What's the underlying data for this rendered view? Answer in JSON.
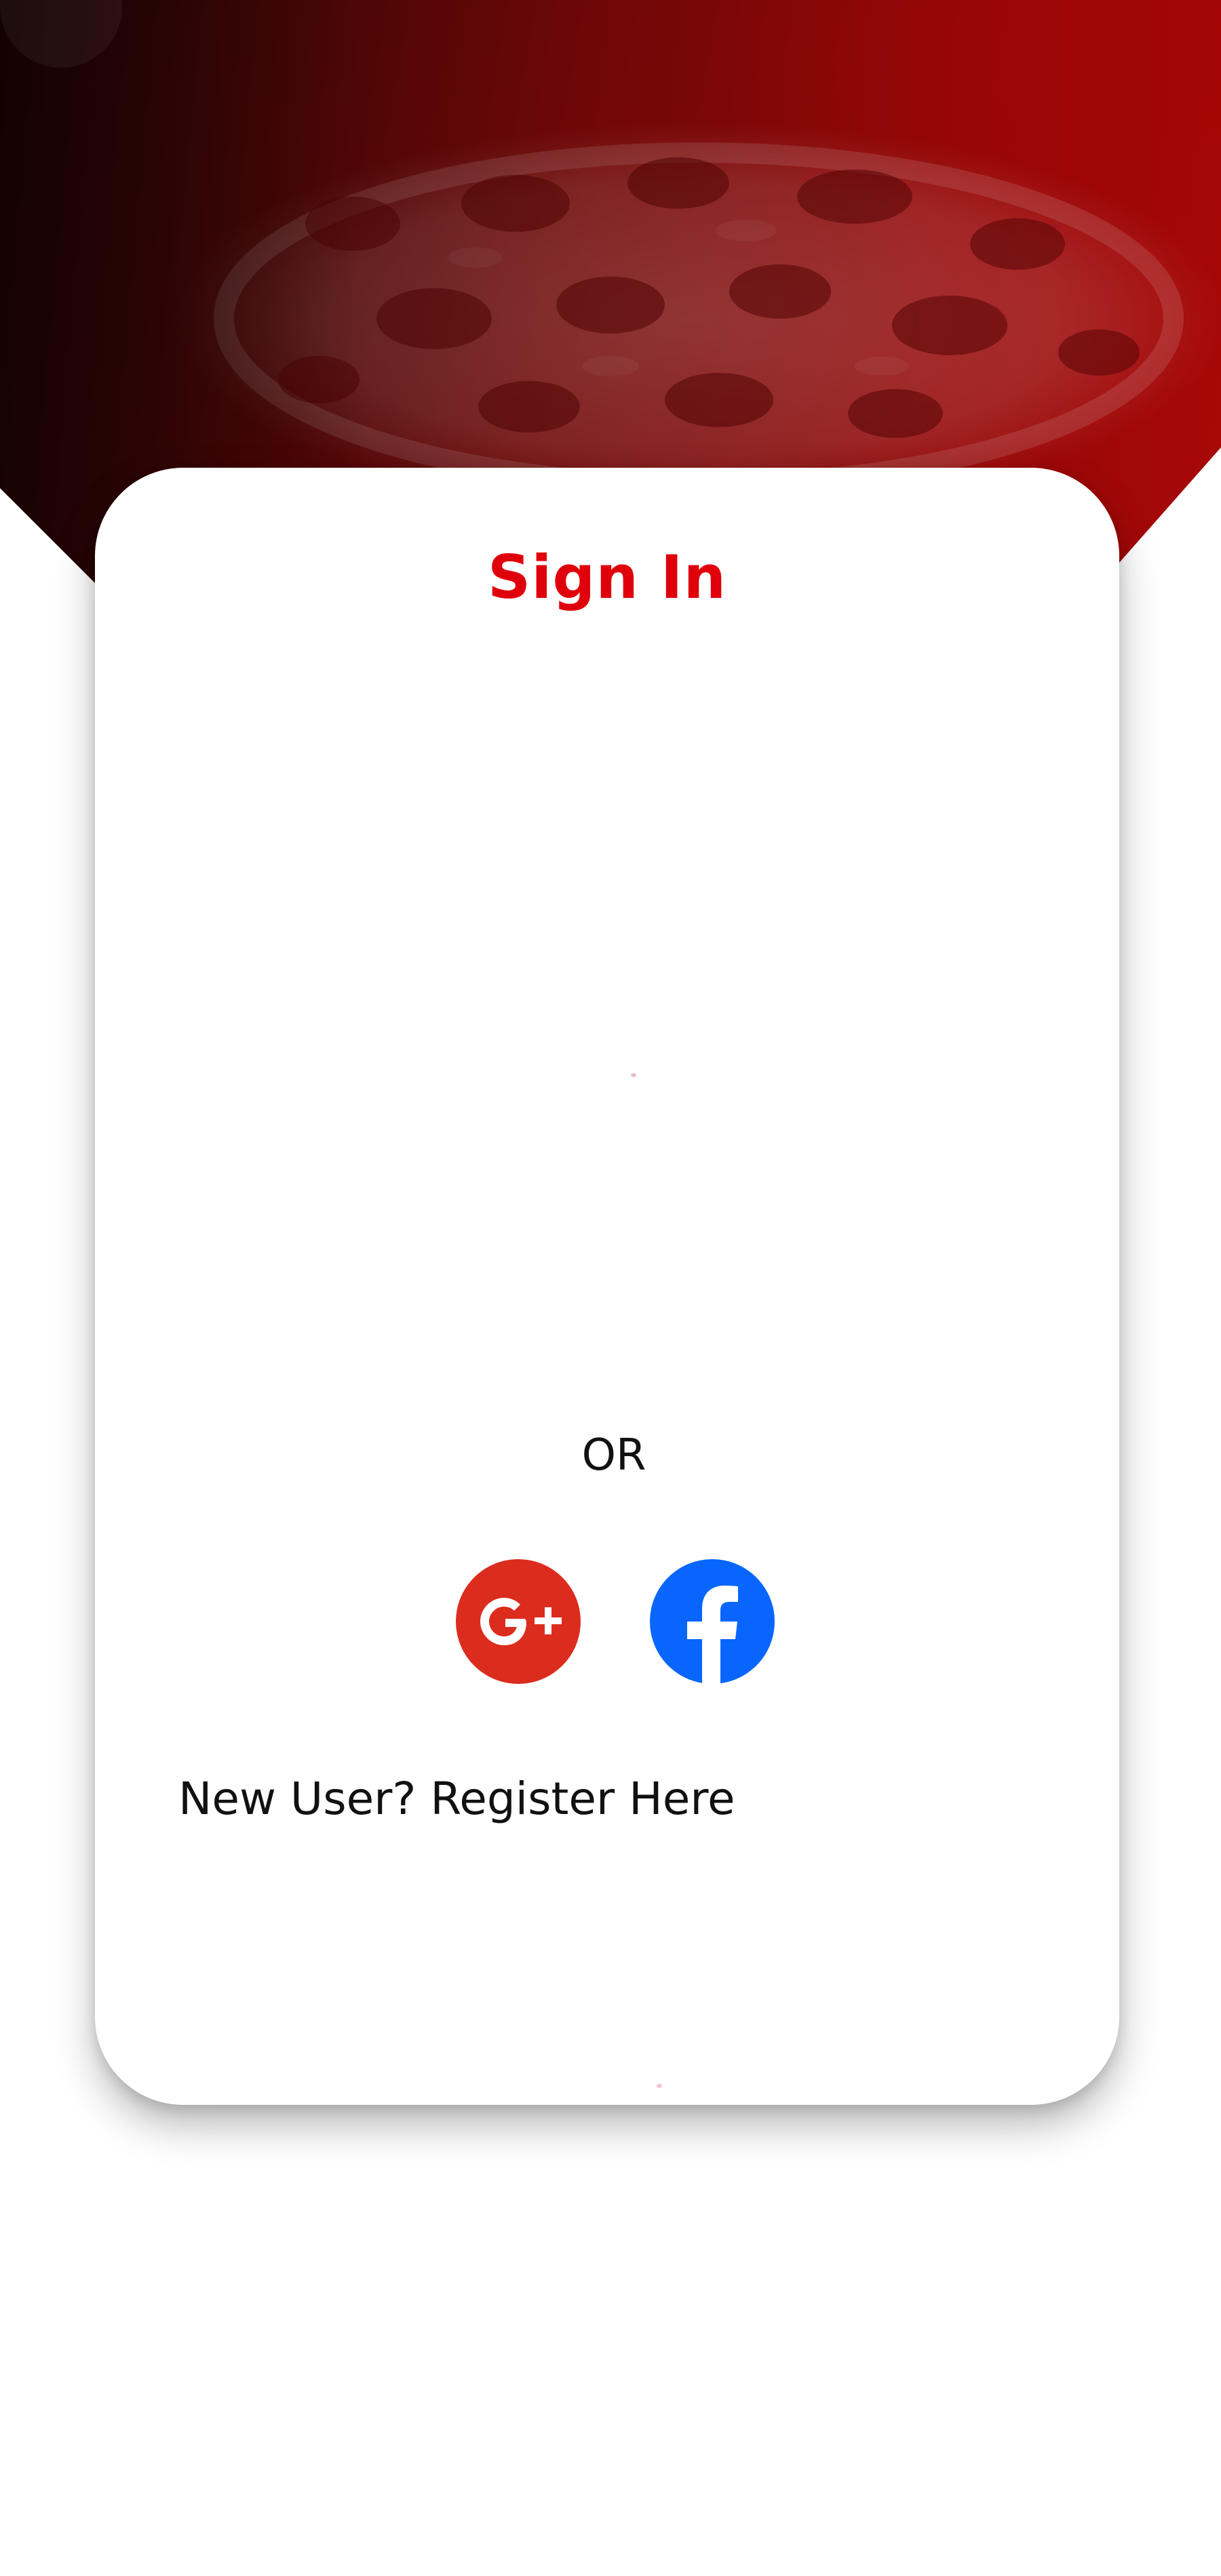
{
  "header": {
    "background_image": "pizza-background",
    "accent_color": "#a80808"
  },
  "card": {
    "title": "Sign In",
    "title_color": "#e0000b",
    "divider_text": "OR",
    "social": [
      {
        "name": "Google Plus",
        "icon": "google-plus-icon",
        "color": "#dc2c1e"
      },
      {
        "name": "Facebook",
        "icon": "facebook-icon",
        "color": "#0866ff"
      }
    ],
    "register_link": "New User? Register Here"
  }
}
